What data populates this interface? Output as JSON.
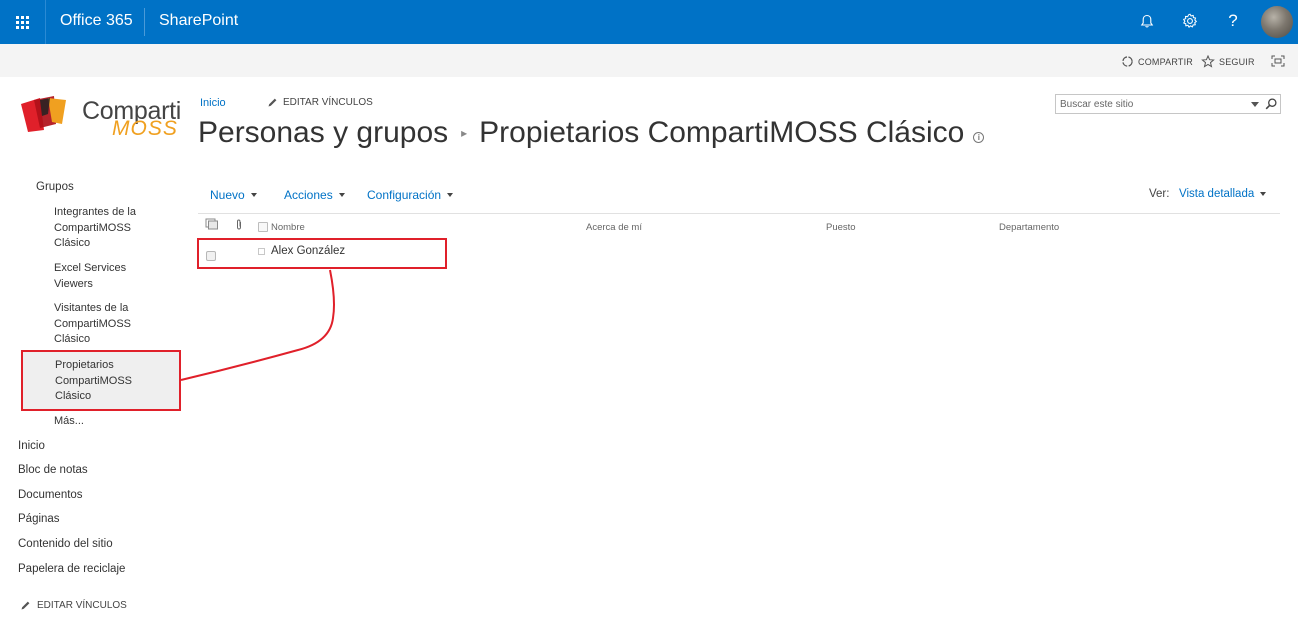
{
  "suitebar": {
    "brand": "Office 365",
    "app": "SharePoint",
    "icons": [
      "bell-icon",
      "gear-icon",
      "help-icon"
    ],
    "help_glyph": "?"
  },
  "ribbon": {
    "share_label": "COMPARTIR",
    "follow_label": "SEGUIR"
  },
  "logo": {
    "line1": "Comparti",
    "line2": "MOSS"
  },
  "topnav": {
    "home_link": "Inicio",
    "edit_links": "EDITAR VÍNCULOS"
  },
  "title": {
    "parent": "Personas y grupos",
    "separator": "▸",
    "current": "Propietarios CompartiMOSS Clásico",
    "info_glyph": "i"
  },
  "search": {
    "placeholder": "Buscar este sitio"
  },
  "leftnav": {
    "groups_heading": "Grupos",
    "groups": [
      "Integrantes de la CompartiMOSS Clásico",
      "Excel Services Viewers",
      "Visitantes de la CompartiMOSS Clásico",
      "Propietarios CompartiMOSS Clásico",
      "Más..."
    ],
    "links": [
      "Inicio",
      "Bloc de notas",
      "Documentos",
      "Páginas",
      "Contenido del sitio",
      "Papelera de reciclaje"
    ],
    "edit_links": "EDITAR VÍNCULOS"
  },
  "commands": {
    "new": "Nuevo",
    "actions": "Acciones",
    "settings": "Configuración",
    "view_label": "Ver:",
    "view_value": "Vista detallada"
  },
  "list": {
    "columns": [
      "Nombre",
      "Acerca de mí",
      "Puesto",
      "Departamento"
    ],
    "rows": [
      {
        "name": "Alex González"
      }
    ]
  },
  "colors": {
    "suitebar": "#0072c6",
    "link": "#0072c6",
    "annotation": "#e0202a",
    "logo_accent": "#f0a020"
  }
}
